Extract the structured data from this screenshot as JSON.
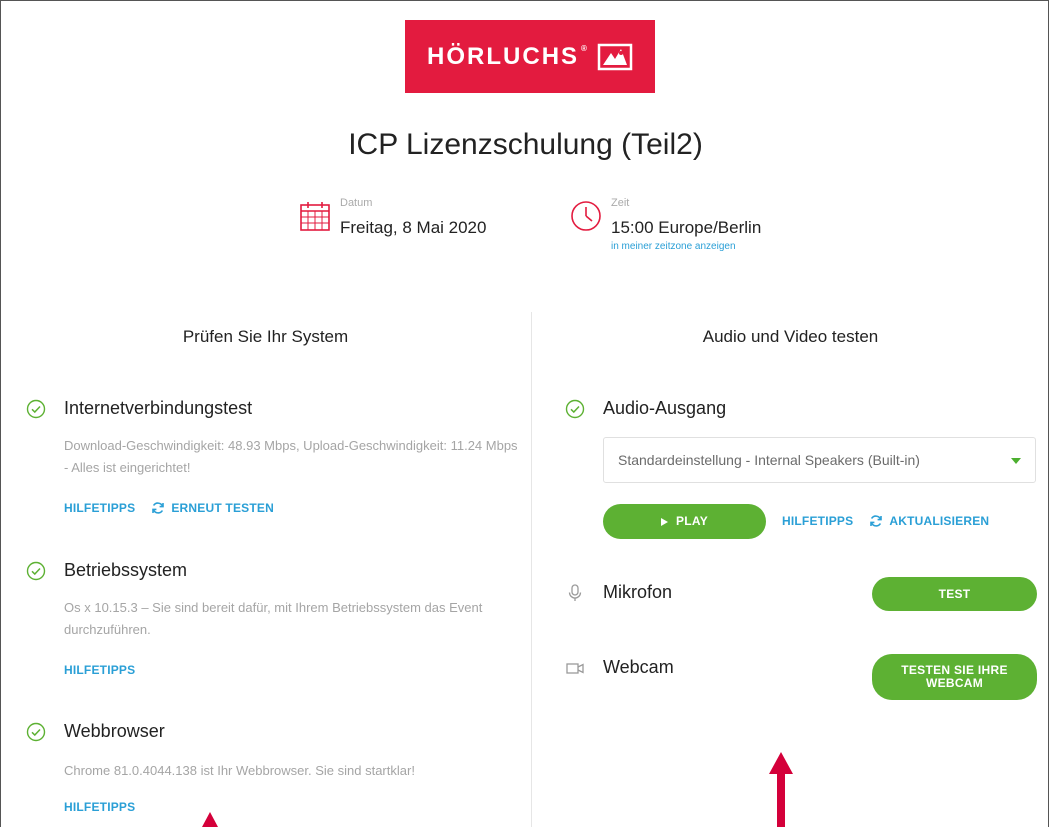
{
  "brand": {
    "name": "HÖRLUCHS",
    "trademark": "®",
    "color": "#e31b3f"
  },
  "event": {
    "title": "ICP Lizenzschulung (Teil2)",
    "date_label": "Datum",
    "date_value": "Freitag, 8 Mai 2020",
    "time_label": "Zeit",
    "time_value": "15:00 Europe/Berlin",
    "timezone_link": "in meiner zeitzone anzeigen"
  },
  "system_check": {
    "title": "Prüfen Sie Ihr System",
    "items": [
      {
        "title": "Internetverbindungstest",
        "description": "Download-Geschwindigkeit: 48.93 Mbps, Upload-Geschwindigkeit: 11.24 Mbps - Alles ist eingerichtet!",
        "help_link": "HILFETIPPS",
        "retest_link": "ERNEUT TESTEN",
        "status": "ok"
      },
      {
        "title": "Betriebssystem",
        "description": "Os x 10.15.3 – Sie sind bereit dafür, mit Ihrem Betriebssystem das Event durchzuführen.",
        "help_link": "HILFETIPPS",
        "status": "ok"
      },
      {
        "title": "Webbrowser",
        "description": "Chrome 81.0.4044.138 ist Ihr Webbrowser. Sie sind startklar!",
        "help_link": "HILFETIPPS",
        "status": "ok"
      }
    ]
  },
  "av_test": {
    "title": "Audio und Video testen",
    "audio_output": {
      "title": "Audio-Ausgang",
      "selected_device": "Standardeinstellung - Internal Speakers (Built-in)",
      "play_label": "PLAY",
      "help_link": "HILFETIPPS",
      "refresh_link": "AKTUALISIEREN",
      "status": "ok"
    },
    "microphone": {
      "title": "Mikrofon",
      "button_label": "TEST"
    },
    "webcam": {
      "title": "Webcam",
      "button_label": "TESTEN SIE IHRE WEBCAM"
    }
  },
  "colors": {
    "accent_green": "#5db133",
    "link_blue": "#2a9fd6",
    "icon_red": "#e31b3f",
    "arrow_red": "#d4003a"
  }
}
